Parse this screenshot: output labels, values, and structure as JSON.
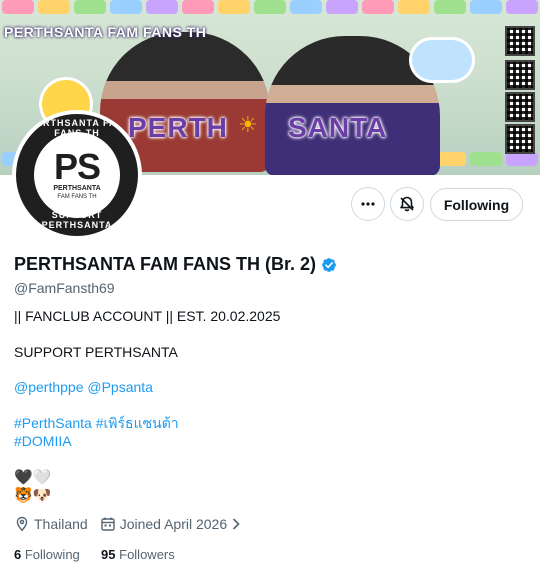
{
  "banner": {
    "topline": "PERTHSANTA FAM FANS TH",
    "word_left": "PERTH",
    "word_right": "SANTA"
  },
  "avatar": {
    "logo_text": "PS",
    "logo_sub": "PERTHSANTA",
    "logo_sub2": "FAM FANS TH",
    "arc_top": "PERTHSANTA FAM FANS TH",
    "arc_bottom": "SUPPORT PERTHSANTA"
  },
  "actions": {
    "more_icon": "more-icon",
    "notify_icon": "bell-icon",
    "follow_label": "Following"
  },
  "profile": {
    "display_name": "PERTHSANTA FAM FANS TH (Br. 2)",
    "handle": "@FamFansth69",
    "bio_line1": "|| FANCLUB ACCOUNT || EST. 20.02.2025",
    "bio_line2": "SUPPORT  PERTHSANTA",
    "mention1": "@perthppe",
    "mention2": "@Ppsanta",
    "hashtag1": "#PerthSanta",
    "hashtag2": "#เพิร์ธแซนต้า",
    "hashtag3": "#DOMIIA",
    "emoji_row1": "🖤🤍",
    "emoji_row2": "🐯🐶"
  },
  "meta": {
    "location": "Thailand",
    "joined": "Joined April 2026"
  },
  "stats": {
    "following_count": "6",
    "following_label": "Following",
    "followers_count": "95",
    "followers_label": "Followers"
  },
  "colors": {
    "link": "#1d9bf0",
    "verified": "#1d9bf0",
    "muted": "#536471"
  }
}
